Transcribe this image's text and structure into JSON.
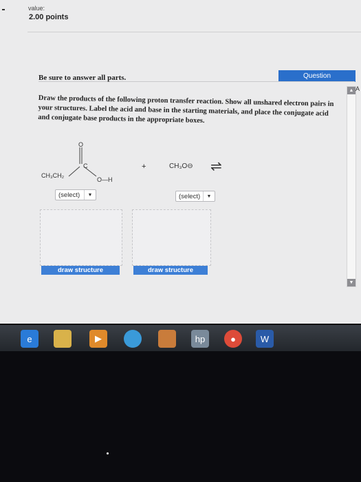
{
  "header": {
    "value_label": "value:",
    "points": "2.00 points"
  },
  "question_tab": "Question",
  "side": {
    "letter": "A",
    "up": "▲",
    "down": "▼"
  },
  "instructions": {
    "line1": "Be sure to answer all parts.",
    "line2": "Draw the products of the following proton transfer reaction. Show all unshared electron pairs in your structures. Label the acid and base in the starting materials, and place the conjugate acid and conjugate base products in the appropriate boxes."
  },
  "reaction": {
    "o_label": "O",
    "c_label": "C",
    "ethyl": "CH₃CH₂",
    "oh": "O—H",
    "plus": "+",
    "methoxide": "CH₃O⊖",
    "arrow": "⇌"
  },
  "selects": {
    "left": "(select)",
    "right": "(select)",
    "caret": "▼"
  },
  "buttons": {
    "draw_left": "draw structure",
    "draw_right": "draw structure"
  },
  "taskbar": [
    "ie-icon",
    "file-explorer-icon",
    "media-player-icon",
    "app-icon",
    "paint-icon",
    "hp-icon",
    "chrome-icon",
    "word-icon"
  ]
}
